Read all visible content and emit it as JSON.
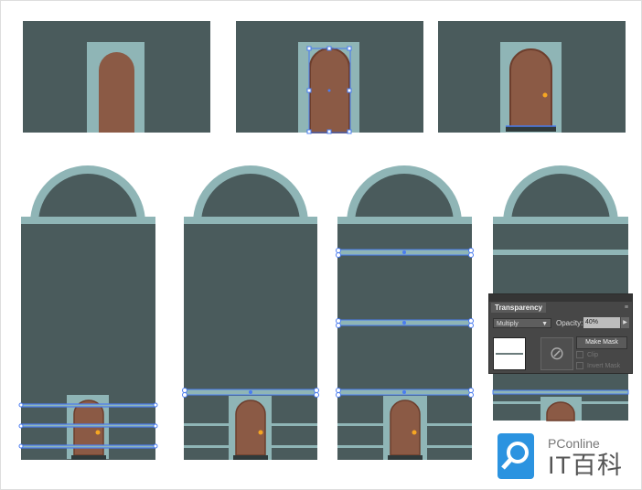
{
  "colors": {
    "wall": "#4a5b5c",
    "trim": "#8fb5b6",
    "door": "#8b5a45",
    "door_edge": "#6d3e2d",
    "knob": "#f5a623",
    "selection": "#4a7cf0",
    "step": "#2f3a3b"
  },
  "transparency_panel": {
    "title": "Transparency",
    "blend_mode": "Multiply",
    "opacity_label": "Opacity:",
    "opacity_value": "40%",
    "make_mask_label": "Make Mask",
    "clip_label": "Clip",
    "invert_mask_label": "Invert Mask"
  },
  "watermark": {
    "brand": "PConline",
    "name": "IT百科"
  }
}
